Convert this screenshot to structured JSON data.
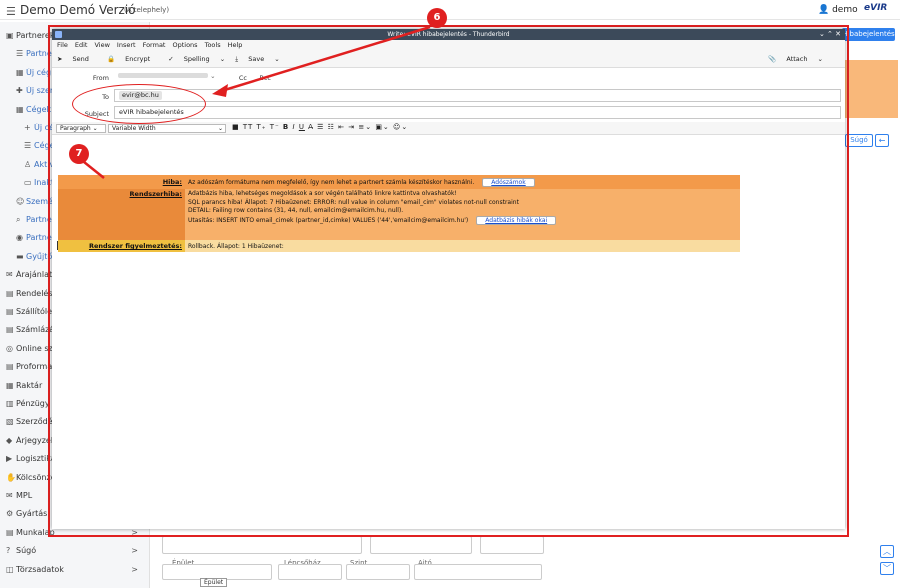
{
  "app": {
    "title": "Demo Demó Verzió",
    "subtitle": "(A telephely)",
    "user": "demo",
    "logo": "eVIR"
  },
  "sidebar": {
    "items": [
      {
        "label": "Partnerek",
        "icon": "handshake-icon",
        "level": 0
      },
      {
        "label": "Partnerek",
        "icon": "list-icon",
        "level": 1
      },
      {
        "label": "Új cég",
        "icon": "building-icon",
        "level": 1
      },
      {
        "label": "Új személy",
        "icon": "user-plus-icon",
        "level": 1
      },
      {
        "label": "Cégek",
        "icon": "building-icon",
        "level": 1
      },
      {
        "label": "Új cég",
        "icon": "plus-icon",
        "level": 2
      },
      {
        "label": "Cégek",
        "icon": "list-icon",
        "level": 2
      },
      {
        "label": "Aktív",
        "icon": "person-icon",
        "level": 2
      },
      {
        "label": "Inaktív",
        "icon": "bed-icon",
        "level": 2
      },
      {
        "label": "Személyek",
        "icon": "users-icon",
        "level": 1
      },
      {
        "label": "Partner keresés",
        "icon": "search-icon",
        "level": 1
      },
      {
        "label": "Partner csoportok",
        "icon": "group-icon",
        "level": 1
      },
      {
        "label": "Gyűjtők",
        "icon": "folder-icon",
        "level": 1
      },
      {
        "label": "Árajánlatok",
        "icon": "chat-icon",
        "level": 0
      },
      {
        "label": "Rendelések",
        "icon": "document-icon",
        "level": 0
      },
      {
        "label": "Szállítólevelek",
        "icon": "document-icon",
        "level": 0
      },
      {
        "label": "Számlázás",
        "icon": "document-icon",
        "level": 0
      },
      {
        "label": "Online számla",
        "icon": "globe-icon",
        "level": 0
      },
      {
        "label": "Proforma",
        "icon": "document-icon",
        "level": 0
      },
      {
        "label": "Raktár",
        "icon": "warehouse-icon",
        "level": 0
      },
      {
        "label": "Pénzügy",
        "icon": "money-icon",
        "level": 0
      },
      {
        "label": "Szerződések",
        "icon": "contract-icon",
        "level": 0
      },
      {
        "label": "Árjegyzék",
        "icon": "tag-icon",
        "level": 0
      },
      {
        "label": "Logisztika",
        "icon": "truck-icon",
        "level": 0
      },
      {
        "label": "Kölcsönzés",
        "icon": "hand-icon",
        "level": 0
      },
      {
        "label": "MPL",
        "icon": "mail-icon",
        "level": 0
      },
      {
        "label": "Gyártás",
        "icon": "cogs-icon",
        "level": 0
      },
      {
        "label": "Munkalap",
        "icon": "document-icon",
        "level": 0,
        "arrow": ">"
      },
      {
        "label": "Súgó",
        "icon": "help-icon",
        "level": 0,
        "arrow": ">"
      },
      {
        "label": "Törzsadatok",
        "icon": "database-icon",
        "level": 0,
        "arrow": ">"
      }
    ]
  },
  "background": {
    "hiba_button": "Hibabejelentés",
    "sugo_button": "Súgó",
    "back_arrow": "←",
    "fields": [
      {
        "label": "Épület"
      },
      {
        "label": "Lépcsőház"
      },
      {
        "label": "Szint"
      },
      {
        "label": "Ajtó"
      }
    ],
    "tooltip": "Épület"
  },
  "thunderbird": {
    "window_title": "Write: eVIR hibabejelentés - Thunderbird",
    "menu": [
      "File",
      "Edit",
      "View",
      "Insert",
      "Format",
      "Options",
      "Tools",
      "Help"
    ],
    "toolbar": {
      "send": "Send",
      "encrypt": "Encrypt",
      "spelling": "Spelling",
      "save": "Save",
      "attach": "Attach"
    },
    "headers": {
      "from_label": "From",
      "cc": "Cc",
      "bcc": "Bcc",
      "to_label": "To",
      "to_value": "evir@bc.hu",
      "subject_label": "Subject",
      "subject_value": "eVIR hibabejelentés"
    },
    "format": {
      "paragraph": "Paragraph",
      "font": "Variable Width"
    },
    "errors": [
      {
        "label": "Hiba:",
        "bg": "#f39a4a",
        "lines": [
          "Az adószám formátuma nem megfelelő, így nem lehet a partnert számla készítéskor használni."
        ],
        "button": "Adószámok"
      },
      {
        "label": "Rendszerhiba:",
        "bg": "#f7b06a",
        "labelbg": "#e98a3a",
        "lines": [
          "Adatbázis hiba, lehetséges megoldások a sor végén található linkre kattintva olvashatók!",
          "SQL parancs hiba! Állapot: 7 Hibaüzenet: ERROR:  null value in column \"email_cim\" violates not-null constraint",
          "DETAIL:  Failing row contains (31, 44, null, emailcim@emailcim.hu, null).",
          "Utasítás: INSERT INTO email_cimek (partner_id,cimke) VALUES ('44','emailcim@emailcim.hu')"
        ],
        "button": "Adatbázis hibák okai"
      },
      {
        "label": "Rendszer figyelmeztetés:",
        "bg": "#f9dca0",
        "labelbg": "#f0c040",
        "lines": [
          "Rollback. Állapot: 1 Hibaüzenet:"
        ]
      }
    ]
  },
  "annotations": {
    "callout_6": "6",
    "callout_7": "7",
    "accent": "#e02020"
  }
}
